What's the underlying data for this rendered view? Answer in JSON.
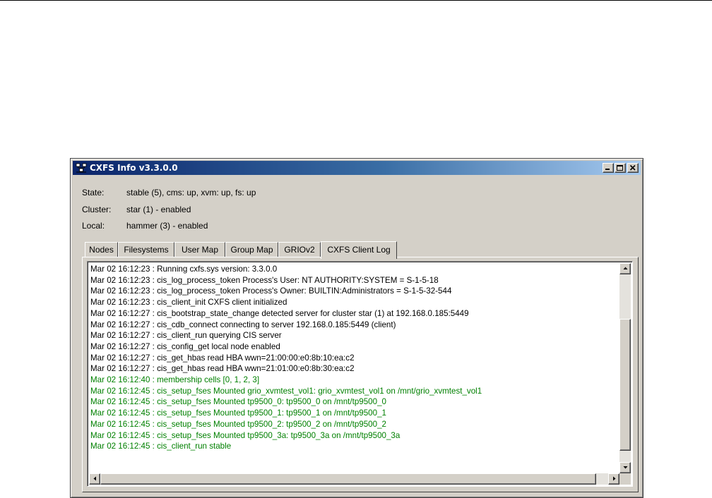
{
  "window": {
    "title": "CXFS Info v3.3.0.0",
    "app_icon": "network-nodes-icon"
  },
  "info": {
    "state_label": "State:",
    "state_value": "stable (5), cms: up, xvm: up, fs: up",
    "cluster_label": "Cluster:",
    "cluster_value": "star (1) - enabled",
    "local_label": "Local:",
    "local_value": "hammer (3) - enabled"
  },
  "tabs": [
    {
      "label": "Nodes",
      "active": false
    },
    {
      "label": "Filesystems",
      "active": false
    },
    {
      "label": "User Map",
      "active": false
    },
    {
      "label": "Group Map",
      "active": false
    },
    {
      "label": "GRIOv2",
      "active": false
    },
    {
      "label": "CXFS Client Log",
      "active": true
    }
  ],
  "log": [
    {
      "text": "Mar 02 16:12:23 : Running cxfs.sys version: 3.3.0.0",
      "color": "black"
    },
    {
      "text": "Mar 02 16:12:23 : cis_log_process_token Process's User: NT AUTHORITY:SYSTEM = S-1-5-18",
      "color": "black"
    },
    {
      "text": "Mar 02 16:12:23 : cis_log_process_token Process's Owner: BUILTIN:Administrators = S-1-5-32-544",
      "color": "black"
    },
    {
      "text": "Mar 02 16:12:23 : cis_client_init CXFS client initialized",
      "color": "black"
    },
    {
      "text": "Mar 02 16:12:27 : cis_bootstrap_state_change detected server for cluster star (1) at 192.168.0.185:5449",
      "color": "black"
    },
    {
      "text": "Mar 02 16:12:27 : cis_cdb_connect connecting to server 192.168.0.185:5449 (client)",
      "color": "black"
    },
    {
      "text": "Mar 02 16:12:27 : cis_client_run querying CIS server",
      "color": "black"
    },
    {
      "text": "Mar 02 16:12:27 : cis_config_get local node enabled",
      "color": "black"
    },
    {
      "text": "Mar 02 16:12:27 : cis_get_hbas read HBA wwn=21:00:00:e0:8b:10:ea:c2",
      "color": "black"
    },
    {
      "text": "Mar 02 16:12:27 : cis_get_hbas read HBA wwn=21:01:00:e0:8b:30:ea:c2",
      "color": "black"
    },
    {
      "text": "Mar 02 16:12:40 : membership cells [0, 1, 2, 3]",
      "color": "green"
    },
    {
      "text": "Mar 02 16:12:45 : cis_setup_fses Mounted grio_xvmtest_vol1: grio_xvmtest_vol1 on /mnt/grio_xvmtest_vol1",
      "color": "green"
    },
    {
      "text": "Mar 02 16:12:45 : cis_setup_fses Mounted tp9500_0: tp9500_0 on /mnt/tp9500_0",
      "color": "green"
    },
    {
      "text": "Mar 02 16:12:45 : cis_setup_fses Mounted tp9500_1: tp9500_1 on /mnt/tp9500_1",
      "color": "green"
    },
    {
      "text": "Mar 02 16:12:45 : cis_setup_fses Mounted tp9500_2: tp9500_2 on /mnt/tp9500_2",
      "color": "green"
    },
    {
      "text": "Mar 02 16:12:45 : cis_setup_fses Mounted tp9500_3a: tp9500_3a on /mnt/tp9500_3a",
      "color": "green"
    },
    {
      "text": "Mar 02 16:12:45 : cis_client_run stable",
      "color": "green"
    }
  ],
  "colors": {
    "titlebar_start": "#0a246a",
    "titlebar_end": "#a6caf0",
    "log_normal": "#000000",
    "log_success": "#008000"
  }
}
